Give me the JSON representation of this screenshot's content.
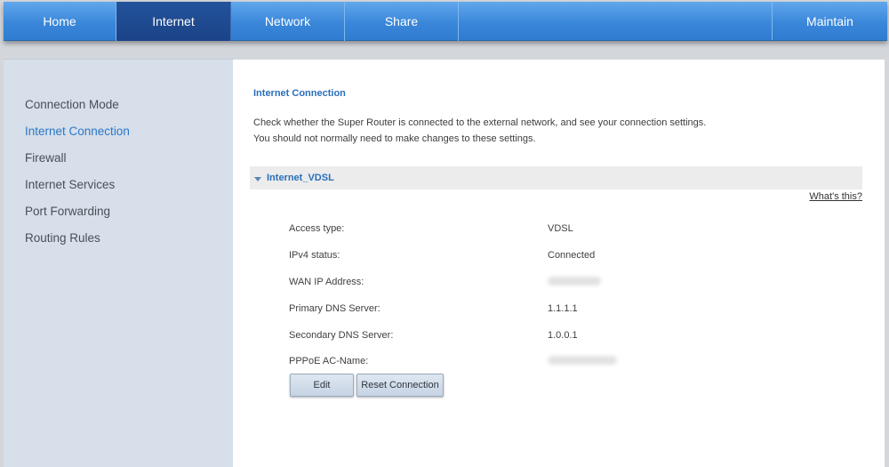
{
  "nav": {
    "tabs": [
      {
        "label": "Home"
      },
      {
        "label": "Internet",
        "active": true
      },
      {
        "label": "Network"
      },
      {
        "label": "Share"
      },
      {
        "label": "Maintain"
      }
    ]
  },
  "sidebar": {
    "items": [
      {
        "label": "Connection Mode"
      },
      {
        "label": "Internet Connection",
        "active": true
      },
      {
        "label": "Firewall"
      },
      {
        "label": "Internet Services"
      },
      {
        "label": "Port Forwarding"
      },
      {
        "label": "Routing Rules"
      }
    ]
  },
  "main": {
    "title": "Internet Connection",
    "desc_line1": "Check whether the Super Router is connected to the external network, and see your connection settings.",
    "desc_line2": "You should not normally need to make changes to these settings.",
    "section_label": "Internet_VDSL",
    "whats_this": "What's this?",
    "details": [
      {
        "label": "Access type:",
        "value": "VDSL"
      },
      {
        "label": "IPv4 status:",
        "value": "Connected"
      },
      {
        "label": "WAN IP Address:",
        "value": ""
      },
      {
        "label": "Primary DNS Server:",
        "value": "1.1.1.1"
      },
      {
        "label": "Secondary DNS Server:",
        "value": "1.0.0.1"
      },
      {
        "label": "PPPoE AC-Name:",
        "value": ""
      }
    ],
    "buttons": {
      "edit": "Edit",
      "reset": "Reset Connection"
    }
  },
  "colors": {
    "nav_blue": "#3a87da",
    "nav_active": "#1b4387",
    "accent_text": "#2c76c6",
    "sidebar_bg": "#d6dfea"
  }
}
